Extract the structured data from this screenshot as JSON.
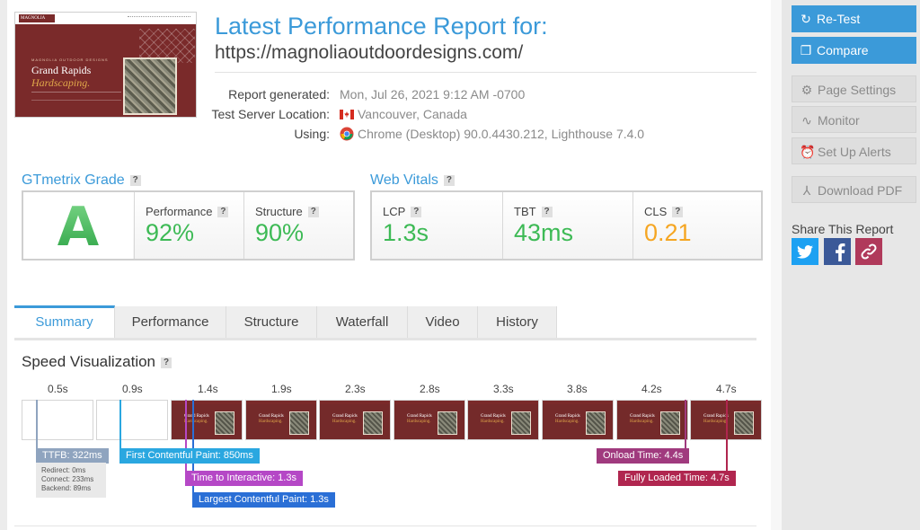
{
  "report": {
    "title": "Latest Performance Report for:",
    "url": "https://magnoliaoutdoordesigns.com/",
    "meta": [
      {
        "label": "Report generated:",
        "value": "Mon, Jul 26, 2021 9:12 AM -0700"
      },
      {
        "label": "Test Server Location:",
        "value": "Vancouver, Canada",
        "icon": "canada-flag-icon"
      },
      {
        "label": "Using:",
        "value": "Chrome (Desktop) 90.0.4430.212, Lighthouse 7.4.0",
        "icon": "chrome-icon"
      }
    ]
  },
  "thumbnail": {
    "logo": "MAGNOLIA",
    "kicker": "MAGNOLIA OUTDOOR DESIGNS",
    "line1": "Grand Rapids",
    "line2": "Hardscaping."
  },
  "grade": {
    "title": "GTmetrix Grade",
    "letter": "A",
    "performance_label": "Performance",
    "performance_value": "92%",
    "structure_label": "Structure",
    "structure_value": "90%",
    "colors": {
      "grade": "#3dba55",
      "good": "#3dba55"
    }
  },
  "vitals": {
    "title": "Web Vitals",
    "lcp_label": "LCP",
    "lcp_value": "1.3s",
    "tbt_label": "TBT",
    "tbt_value": "43ms",
    "cls_label": "CLS",
    "cls_value": "0.21",
    "colors": {
      "good": "#3dba55",
      "warn": "#f5a623"
    }
  },
  "help_mark": "?",
  "tabs": [
    "Summary",
    "Performance",
    "Structure",
    "Waterfall",
    "Video",
    "History"
  ],
  "active_tab": "Summary",
  "speed": {
    "title": "Speed Visualization",
    "frame_times": [
      "0.5s",
      "0.9s",
      "1.4s",
      "1.9s",
      "2.3s",
      "2.8s",
      "3.3s",
      "3.8s",
      "4.2s",
      "4.7s"
    ],
    "frame_text_1": "Grand Rapids",
    "frame_text_2": "Hardscaping.",
    "markers": {
      "ttfb": "TTFB: 322ms",
      "redirect": "Redirect: 0ms",
      "connect": "Connect: 233ms",
      "backend": "Backend: 89ms",
      "fcp": "First Contentful Paint: 850ms",
      "tti": "Time to Interactive: 1.3s",
      "lcp": "Largest Contentful Paint: 1.3s",
      "onload": "Onload Time: 4.4s",
      "fully_loaded": "Fully Loaded Time: 4.7s"
    },
    "colors": {
      "ttfb": "#8fa4bf",
      "fcp": "#2aa7e0",
      "tti": "#b548c6",
      "lcp": "#2a6fd6",
      "onload": "#a03a7e",
      "fully_loaded": "#b0264f"
    }
  },
  "sidebar": {
    "retest": "Re-Test",
    "compare": "Compare",
    "page_settings": "Page Settings",
    "monitor": "Monitor",
    "alerts": "Set Up Alerts",
    "pdf": "Download PDF",
    "share_title": "Share This Report",
    "share_icons": [
      "twitter-icon",
      "facebook-icon",
      "link-icon"
    ],
    "colors": {
      "primary": "#3b9ad9",
      "twitter": "#1da1f2",
      "facebook": "#3b5998",
      "link": "#b03a5b"
    }
  }
}
